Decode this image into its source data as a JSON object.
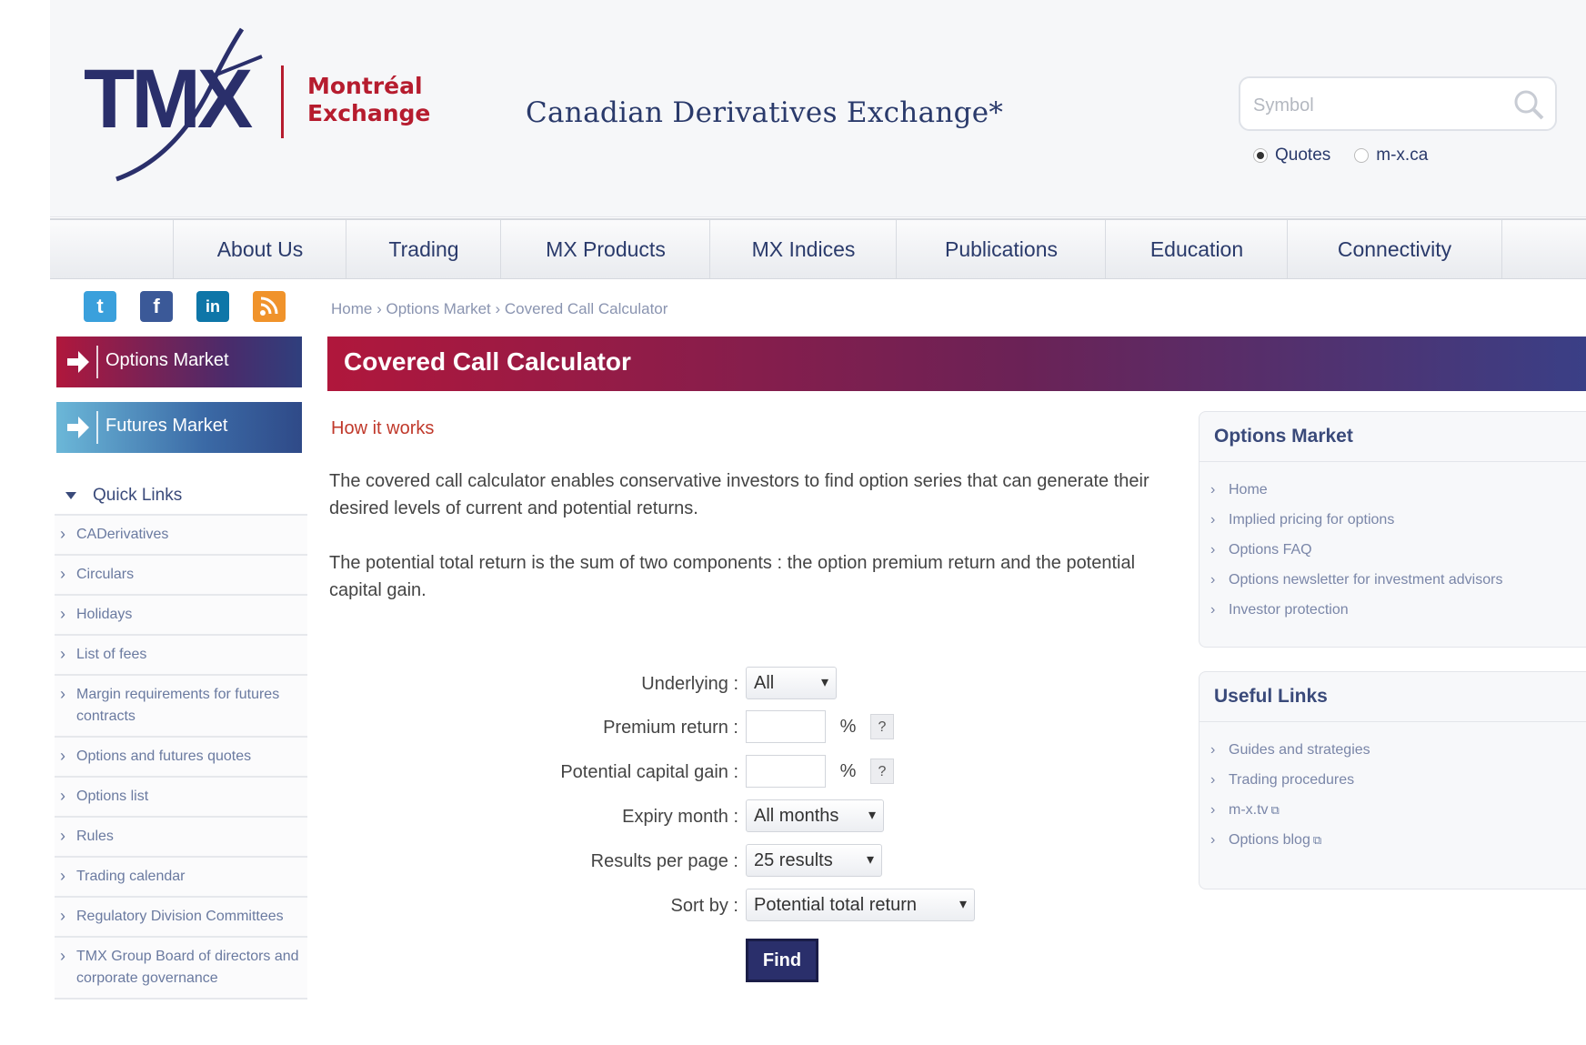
{
  "header": {
    "logo_text": "TMX",
    "exchange_name_line1": "Montréal",
    "exchange_name_line2": "Exchange",
    "tagline": "Canadian Derivatives Exchange*",
    "search_placeholder": "Symbol",
    "radio_options": [
      {
        "label": "Quotes",
        "selected": true
      },
      {
        "label": "m-x.ca",
        "selected": false
      }
    ]
  },
  "nav": {
    "items": [
      "About Us",
      "Trading",
      "MX Products",
      "MX Indices",
      "Publications",
      "Education",
      "Connectivity"
    ]
  },
  "social": {
    "icons": [
      "twitter-icon",
      "facebook-icon",
      "linkedin-icon",
      "rss-icon"
    ]
  },
  "sidebar": {
    "options_market": "Options Market",
    "futures_market": "Futures Market",
    "quick_links_title": "Quick Links",
    "quick_links": [
      "CADerivatives",
      "Circulars",
      "Holidays",
      "List of fees",
      "Margin requirements for futures contracts",
      "Options and futures quotes",
      "Options list",
      "Rules",
      "Trading calendar",
      "Regulatory Division Committees",
      "TMX Group Board of directors and corporate governance"
    ]
  },
  "breadcrumb": {
    "home": "Home",
    "section": "Options Market",
    "current": "Covered Call Calculator",
    "separator": "›"
  },
  "main": {
    "title": "Covered Call Calculator",
    "how_it_works": "How it works",
    "paragraph1": "The covered call calculator enables conservative investors to find option series that can generate their desired levels of current and potential returns.",
    "paragraph2": "The potential total return is the sum of two components : the option premium return and the potential capital gain."
  },
  "form": {
    "underlying_label": "Underlying :",
    "underlying_value": "All",
    "premium_label": "Premium return :",
    "premium_value": "",
    "capital_label": "Potential capital gain :",
    "capital_value": "",
    "percent": "%",
    "help": "?",
    "expiry_label": "Expiry month :",
    "expiry_value": "All months",
    "results_label": "Results per page :",
    "results_value": "25 results",
    "sort_label": "Sort by :",
    "sort_value": "Potential total return",
    "find_label": "Find"
  },
  "right_panels": {
    "options_title": "Options Market",
    "options_links": [
      "Home",
      "Implied pricing for options",
      "Options FAQ",
      "Options newsletter for investment advisors",
      "Investor protection"
    ],
    "useful_title": "Useful Links",
    "useful_links": [
      "Guides and strategies",
      "Trading procedures",
      "m-x.tv",
      "Options blog"
    ],
    "external_icon": "external-link-icon"
  },
  "colors": {
    "brand_navy": "#2a3a6b",
    "brand_red": "#b61c2e",
    "title_gradient_start": "#b0173c",
    "title_gradient_end": "#3a3f86",
    "futures_blue": "#6bb7d8"
  }
}
